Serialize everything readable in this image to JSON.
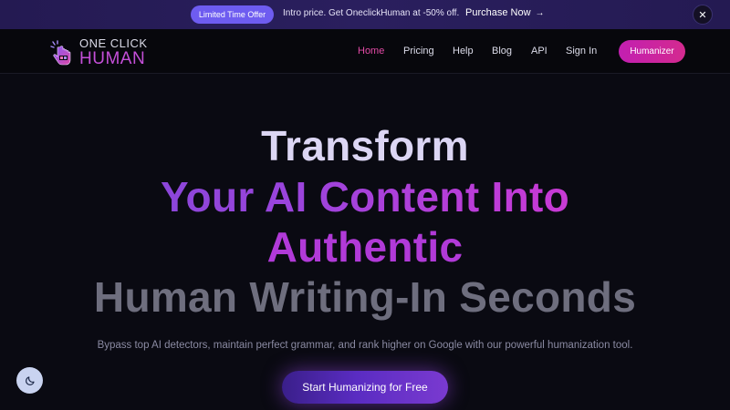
{
  "promo": {
    "badge": "Limited Time Offer",
    "text": "Intro price. Get OneclickHuman at -50% off.",
    "link_label": "Purchase Now",
    "link_icon": "arrow-right-icon",
    "close_label": "✕"
  },
  "logo": {
    "line1": "ONE CLICK",
    "line2": "HUMAN",
    "icon": "hand-cursor-icon"
  },
  "nav": {
    "items": [
      {
        "label": "Home",
        "active": true
      },
      {
        "label": "Pricing"
      },
      {
        "label": "Help"
      },
      {
        "label": "Blog"
      },
      {
        "label": "API"
      },
      {
        "label": "Sign In"
      }
    ],
    "cta_label": "Humanizer"
  },
  "hero": {
    "line1": "Transform",
    "line2": "Your AI Content Into",
    "line3": "Authentic",
    "line4": "Human Writing-In Seconds",
    "subtitle": "Bypass top AI detectors, maintain perfect grammar, and rank higher on Google with our powerful humanization tool.",
    "cta_label": "Start Humanizing for Free"
  },
  "theme_toggle": {
    "icon": "moon-icon"
  },
  "colors": {
    "accent_pink": "#d42a8f",
    "accent_purple": "#7a48d6",
    "promo_badge": "#6e5cf0",
    "background": "#0a0a12"
  }
}
